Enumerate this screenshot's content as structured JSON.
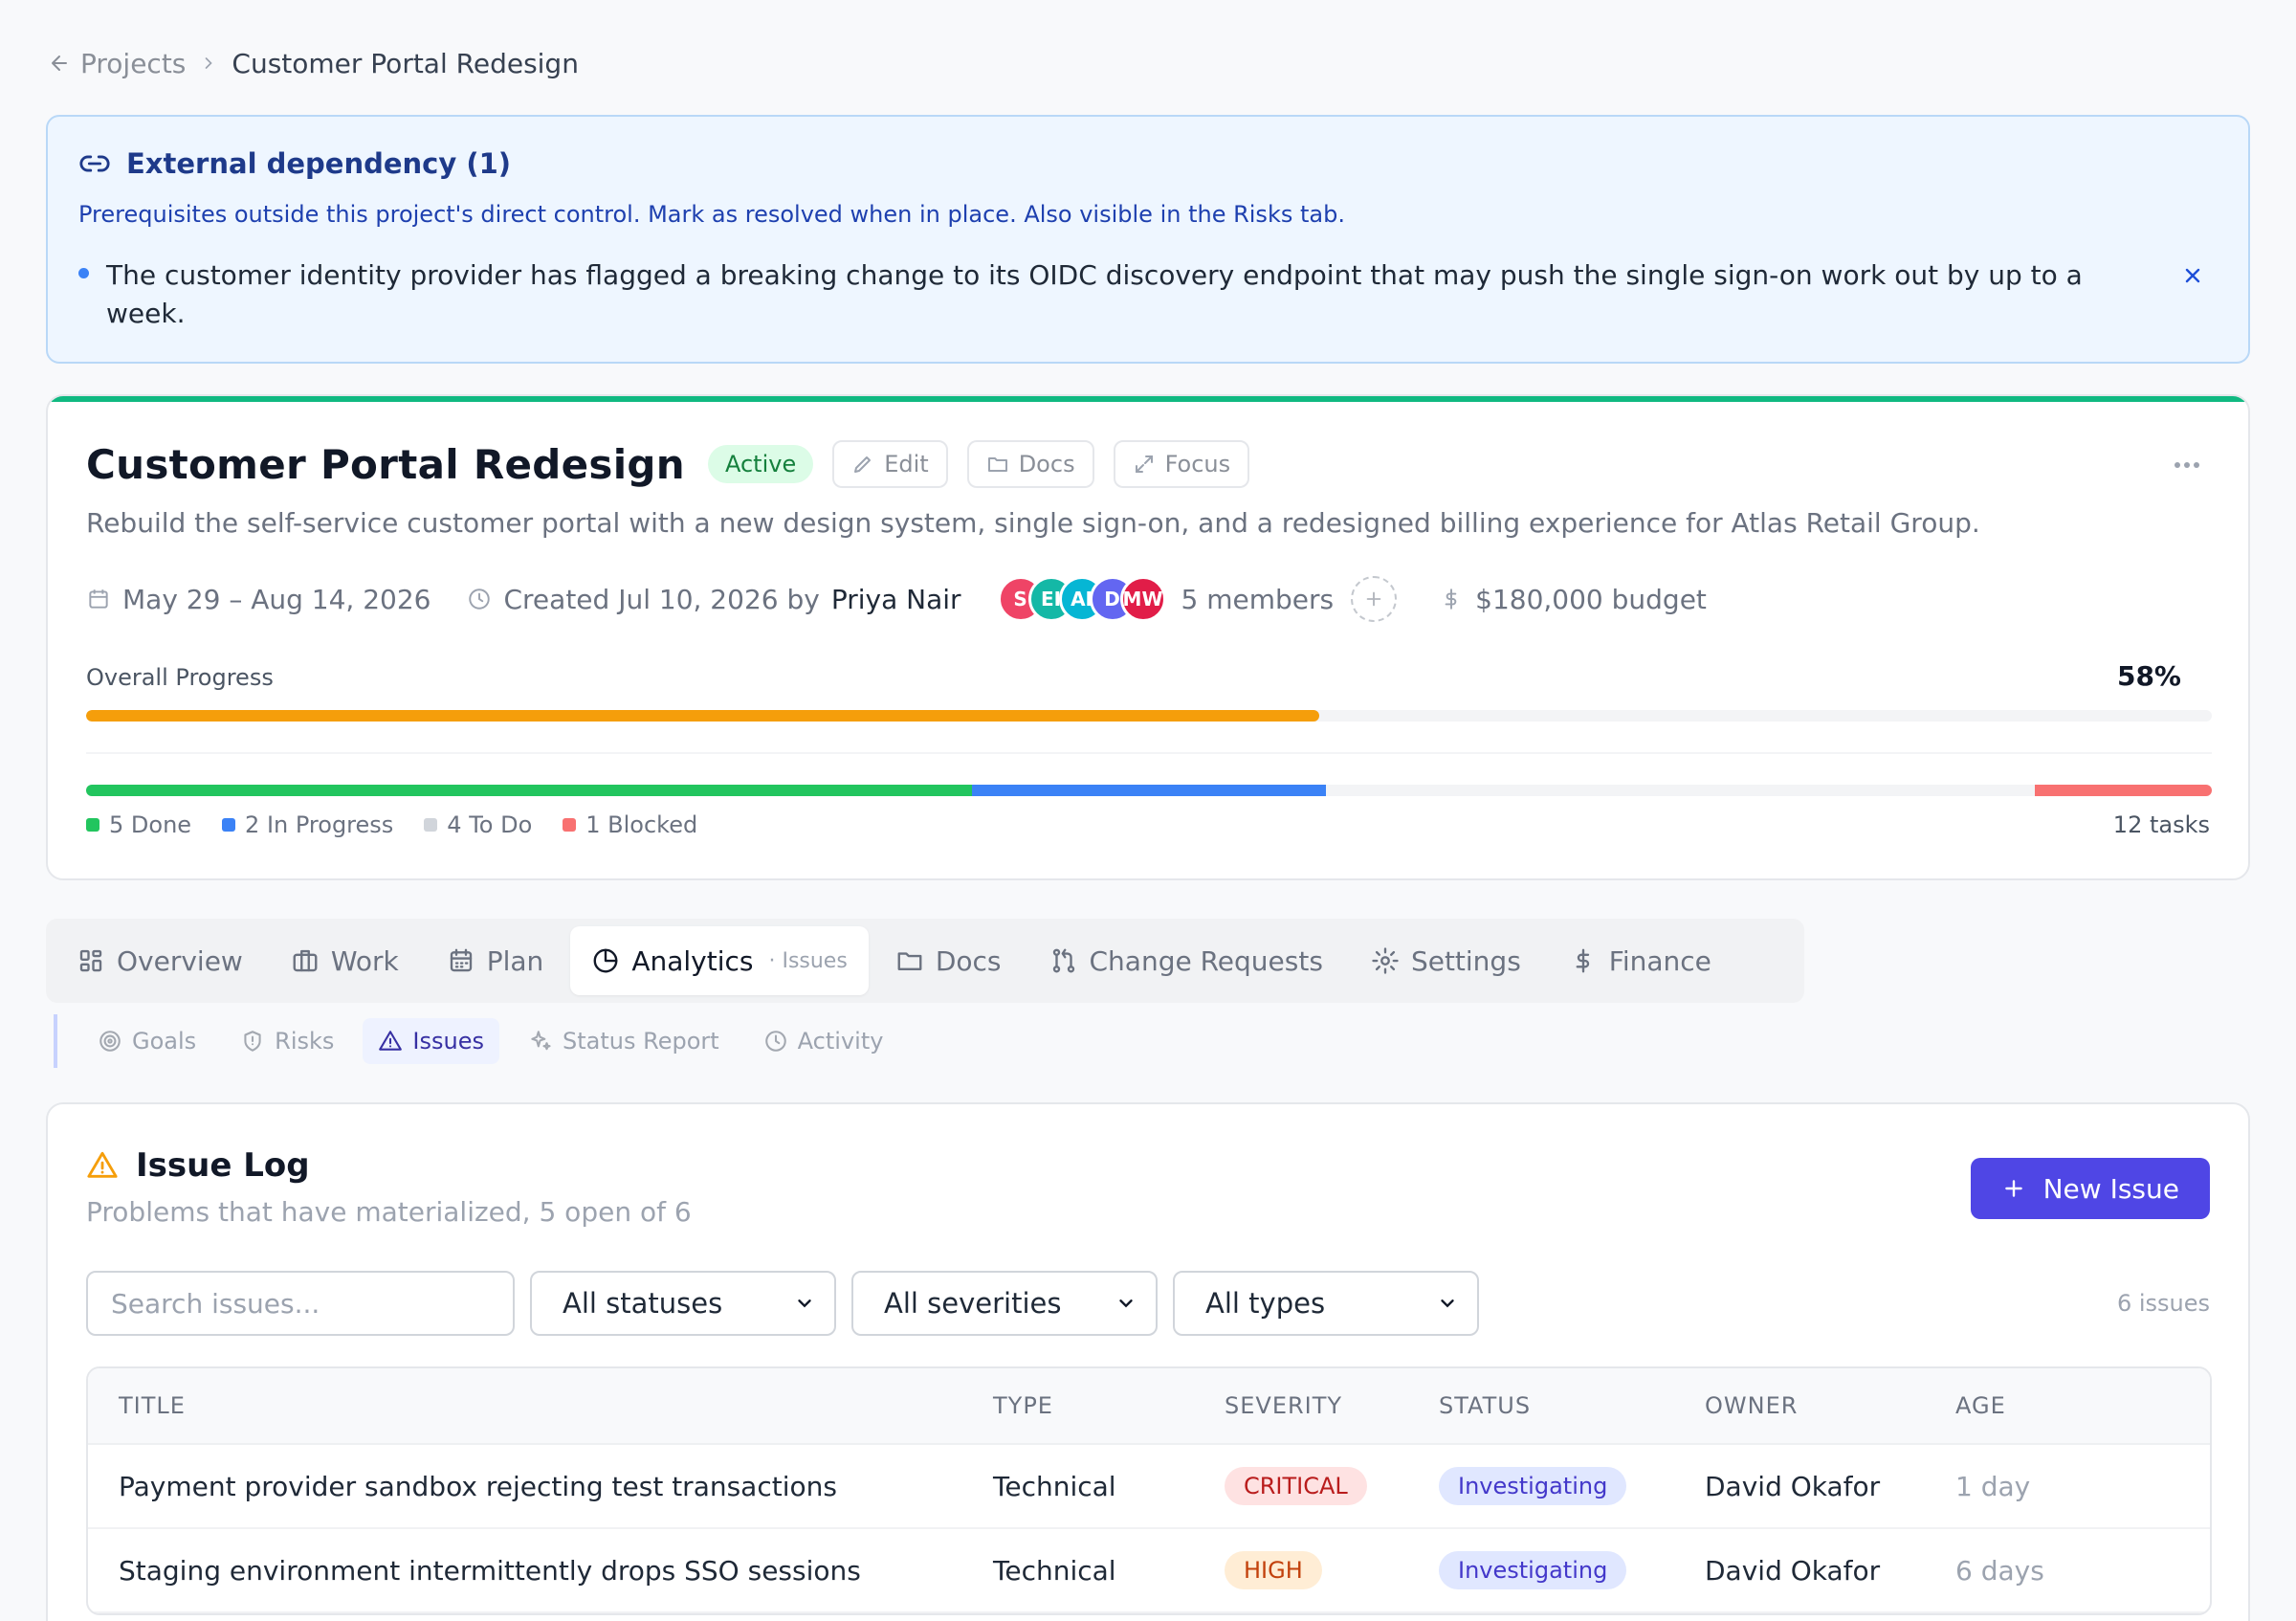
{
  "breadcrumb": {
    "back": "Projects",
    "current": "Customer Portal Redesign"
  },
  "alert": {
    "title": "External dependency (1)",
    "subtitle": "Prerequisites outside this project's direct control. Mark as resolved when in place. Also visible in the Risks tab.",
    "item": "The customer identity provider has flagged a breaking change to its OIDC discovery endpoint that may push the single sign-on work out by up to a week."
  },
  "project": {
    "title": "Customer Portal Redesign",
    "status": "Active",
    "buttons": {
      "edit": "Edit",
      "docs": "Docs",
      "focus": "Focus"
    },
    "description": "Rebuild the self-service customer portal with a new design system, single sign-on, and a redesigned billing experience for Atlas Retail Group.",
    "dates": "May 29 – Aug 14, 2026",
    "created": "Created Jul 10, 2026 by",
    "creator": "Priya Nair",
    "members": [
      {
        "initials": "S",
        "color": "#ef4466"
      },
      {
        "initials": "EI",
        "color": "#14b8a6"
      },
      {
        "initials": "AI",
        "color": "#06b6d4"
      },
      {
        "initials": "D",
        "color": "#6366f1"
      },
      {
        "initials": "MW",
        "color": "#e11d48"
      }
    ],
    "members_label": "5 members",
    "budget": "$180,000 budget",
    "progress_label": "Overall Progress",
    "progress_pct": "58%",
    "progress_value": 0.58,
    "task_breakdown": [
      {
        "label": "5 Done",
        "count": 5,
        "color": "#22c55e"
      },
      {
        "label": "2 In Progress",
        "count": 2,
        "color": "#3b82f6"
      },
      {
        "label": "4 To Do",
        "count": 4,
        "color": "#d1d5db"
      },
      {
        "label": "1 Blocked",
        "count": 1,
        "color": "#f87171"
      }
    ],
    "task_total": 12,
    "task_count_label": "12 tasks"
  },
  "tabs": [
    {
      "label": "Overview",
      "icon": "grid-icon"
    },
    {
      "label": "Work",
      "icon": "briefcase-icon"
    },
    {
      "label": "Plan",
      "icon": "calendar-icon"
    },
    {
      "label": "Analytics",
      "icon": "pie-chart-icon",
      "hint": "· Issues"
    },
    {
      "label": "Docs",
      "icon": "folder-icon"
    },
    {
      "label": "Change Requests",
      "icon": "git-pull-request-icon"
    },
    {
      "label": "Settings",
      "icon": "gear-icon"
    },
    {
      "label": "Finance",
      "icon": "dollar-icon"
    }
  ],
  "subtabs": [
    {
      "label": "Goals",
      "icon": "target-icon"
    },
    {
      "label": "Risks",
      "icon": "shield-icon"
    },
    {
      "label": "Issues",
      "icon": "warning-icon"
    },
    {
      "label": "Status Report",
      "icon": "sparkle-icon"
    },
    {
      "label": "Activity",
      "icon": "clock-icon"
    }
  ],
  "issues": {
    "title": "Issue Log",
    "subtitle": "Problems that have materialized, 5 open of 6",
    "new_button": "New Issue",
    "search_placeholder": "Search issues...",
    "filters": {
      "status": "All statuses",
      "severity": "All severities",
      "type": "All types"
    },
    "count_label": "6 issues",
    "columns": [
      "TITLE",
      "TYPE",
      "SEVERITY",
      "STATUS",
      "OWNER",
      "AGE"
    ],
    "rows": [
      {
        "title": "Payment provider sandbox rejecting test transactions",
        "type": "Technical",
        "severity": "CRITICAL",
        "status": "Investigating",
        "owner": "David Okafor",
        "age": "1 day"
      },
      {
        "title": "Staging environment intermittently drops SSO sessions",
        "type": "Technical",
        "severity": "HIGH",
        "status": "Investigating",
        "owner": "David Okafor",
        "age": "6 days"
      }
    ]
  },
  "colors": {
    "accent": "#4f46e5",
    "project_bar": "#10b981",
    "progress": "#f59e0b"
  }
}
